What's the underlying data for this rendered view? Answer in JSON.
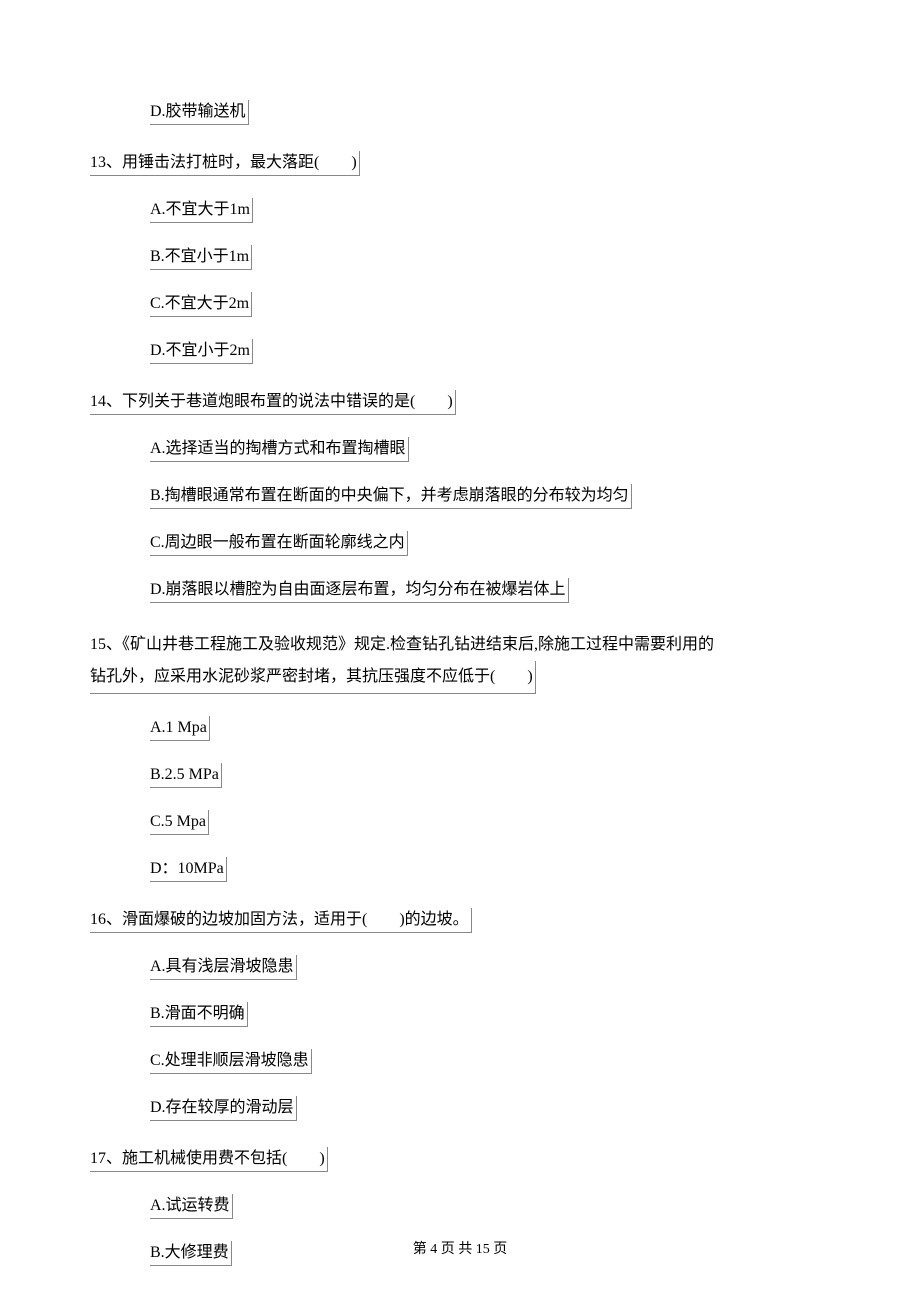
{
  "remainder_option": "D.胶带输送机",
  "questions": [
    {
      "num": "13、",
      "text": "用锤击法打桩时，最大落距(　　)",
      "options": [
        "A.不宜大于1m",
        "B.不宜小于1m",
        "C.不宜大于2m",
        "D.不宜小于2m"
      ]
    },
    {
      "num": "14、",
      "text": "下列关于巷道炮眼布置的说法中错误的是(　　)",
      "options": [
        "A.选择适当的掏槽方式和布置掏槽眼",
        "B.掏槽眼通常布置在断面的中央偏下，并考虑崩落眼的分布较为均匀",
        "C.周边眼一般布置在断面轮廓线之内",
        "D.崩落眼以槽腔为自由面逐层布置，均匀分布在被爆岩体上"
      ]
    },
    {
      "num": "15、",
      "text_lines": [
        "《矿山井巷工程施工及验收规范》规定.检查钻孔钻进结束后,除施工过程中需要利用的",
        "钻孔外，应采用水泥砂浆严密封堵，其抗压强度不应低于(　　)"
      ],
      "options": [
        "A.1 Mpa",
        "B.2.5 MPa",
        "C.5 Mpa",
        "D：10MPa"
      ]
    },
    {
      "num": "16、",
      "text": "滑面爆破的边坡加固方法，适用于(　　)的边坡。",
      "options": [
        "A.具有浅层滑坡隐患",
        "B.滑面不明确",
        "C.处理非顺层滑坡隐患",
        "D.存在较厚的滑动层"
      ]
    },
    {
      "num": "17、",
      "text": "施工机械使用费不包括(　　)",
      "options": [
        "A.试运转费",
        "B.大修理费"
      ]
    }
  ],
  "footer": "第 4 页 共 15 页"
}
